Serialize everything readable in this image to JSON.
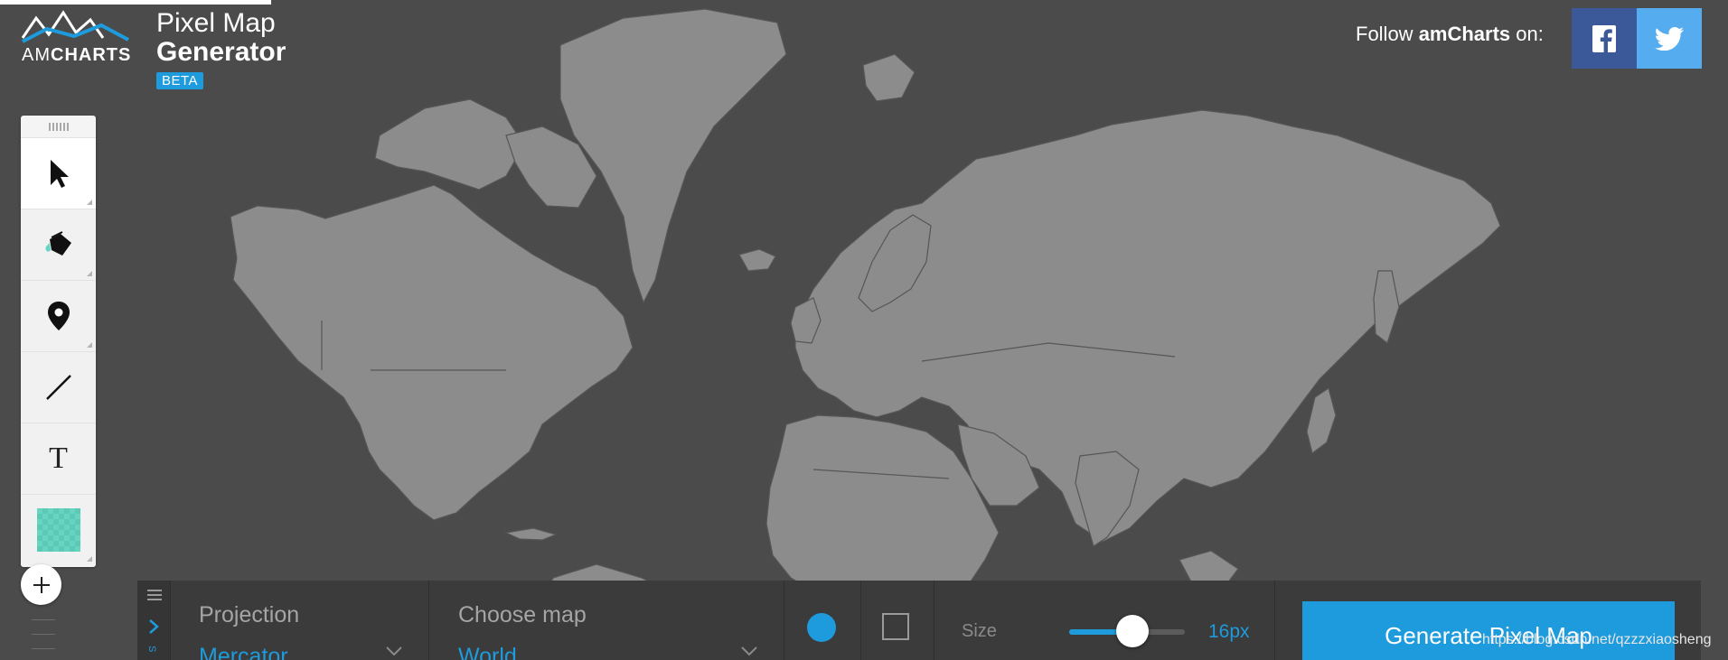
{
  "brand": {
    "logo_text_light": "AM",
    "logo_text_bold": "CHARTS",
    "title_line1": "Pixel Map",
    "title_line2": "Generator",
    "badge": "BETA"
  },
  "social": {
    "follow_prefix": "Follow ",
    "follow_brand": "amCharts",
    "follow_suffix": " on:",
    "facebook_icon": "facebook-icon",
    "twitter_icon": "twitter-icon",
    "facebook_color": "#3b5998",
    "twitter_color": "#55acee"
  },
  "toolbar": {
    "tools": [
      {
        "name": "select-tool",
        "icon": "cursor-icon"
      },
      {
        "name": "fill-tool",
        "icon": "paint-bucket-icon"
      },
      {
        "name": "marker-tool",
        "icon": "map-pin-icon"
      },
      {
        "name": "line-tool",
        "icon": "line-icon"
      },
      {
        "name": "text-tool",
        "icon": "text-icon",
        "label": "T"
      },
      {
        "name": "color-tool",
        "icon": "color-swatch-icon",
        "color": "#67d4c2"
      }
    ],
    "add_icon": "plus-icon"
  },
  "panel": {
    "side_label": "S",
    "projection_label": "Projection",
    "projection_value": "Mercator",
    "map_label": "Choose map",
    "map_value": "World",
    "shape_selected": "circle",
    "size_label": "Size",
    "size_value": "16px",
    "size_fraction": 0.55,
    "generate_label": "Generate Pixel Map"
  },
  "colors": {
    "accent": "#1e9bdc",
    "background": "#4b4b4b",
    "land": "#8c8c8c"
  },
  "watermark": "https://blog.csdn.net/qzzzxiaosheng"
}
